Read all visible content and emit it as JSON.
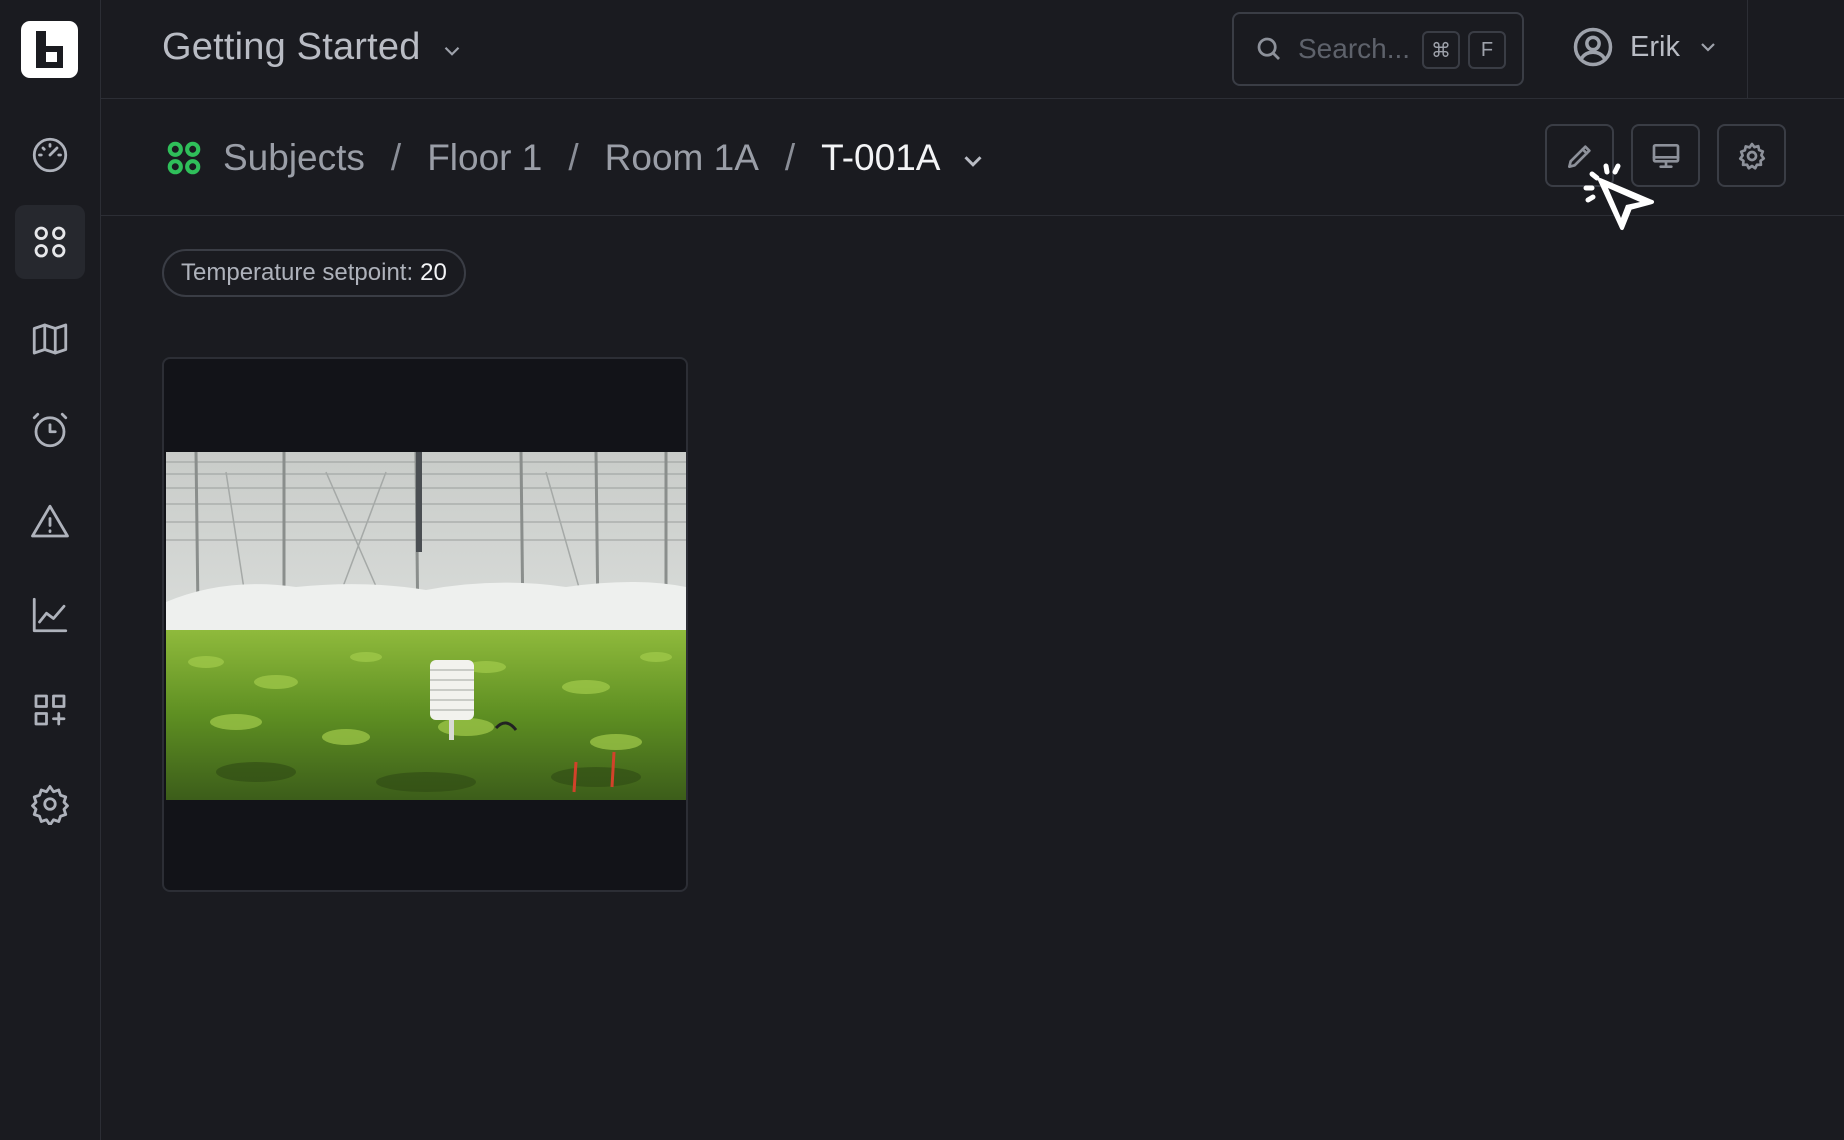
{
  "header": {
    "workspace_title": "Getting Started",
    "search_placeholder": "Search...",
    "shortcut_cmd": "⌘",
    "shortcut_key": "F",
    "user_name": "Erik"
  },
  "breadcrumb": {
    "items": [
      "Subjects",
      "Floor 1",
      "Room 1A"
    ],
    "separator": "/",
    "current": "T-001A"
  },
  "sidebar": {
    "items": [
      {
        "icon": "dashboard-gauge-icon",
        "active": false
      },
      {
        "icon": "subjects-grid-icon",
        "active": true
      },
      {
        "icon": "map-icon",
        "active": false
      },
      {
        "icon": "alarm-clock-icon",
        "active": false
      },
      {
        "icon": "warning-triangle-icon",
        "active": false
      },
      {
        "icon": "line-chart-icon",
        "active": false
      },
      {
        "icon": "add-widget-icon",
        "active": false
      },
      {
        "icon": "settings-gear-icon",
        "active": false
      }
    ]
  },
  "toolbar": {
    "buttons": [
      "edit-pencil-icon",
      "display-monitor-icon",
      "settings-gear-icon"
    ]
  },
  "content": {
    "pill_label": "Temperature setpoint:",
    "pill_value": "20"
  },
  "colors": {
    "background": "#1a1b20",
    "accent_green": "#2fbf5a",
    "border": "#3a3d45"
  }
}
